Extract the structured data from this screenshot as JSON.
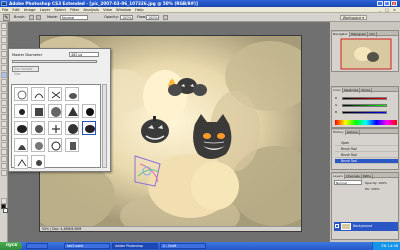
{
  "window": {
    "title": "Adobe Photoshop CS3 Extended - [pic_2007-03-06_107326.jpg @ 50% (RGB/8#)]",
    "app_icon_label": "Ps",
    "minimize_label": "_",
    "maximize_label": "□",
    "close_label": "×"
  },
  "menubar": {
    "items": [
      "File",
      "Edit",
      "Image",
      "Layer",
      "Select",
      "Filter",
      "Analysis",
      "View",
      "Window",
      "Help"
    ],
    "window_controls": [
      "_",
      "□",
      "×"
    ]
  },
  "options_bar": {
    "brush_label": "Brush:",
    "mode_label": "Mode:",
    "mode_value": "Normal",
    "opacity_label": "Opacity:",
    "opacity_value": "100%",
    "flow_label": "Flow:",
    "flow_value": "100%",
    "workspace_label": "Workspace ▾"
  },
  "brush_picker": {
    "master_diameter_label": "Master Diameter",
    "master_diameter_value": "482 px",
    "use_sample_size_label": "Use Sample Size",
    "brush_sizes": [
      "",
      "",
      "",
      "",
      "",
      "",
      "",
      "",
      "",
      "",
      "",
      "",
      "",
      "",
      "",
      "",
      "",
      "",
      "",
      ""
    ]
  },
  "document": {
    "zoom": "50%",
    "status": "50% | Doc: 4,48M/8,96M"
  },
  "panels": {
    "navigator_tabs": [
      "Navigator",
      "Histogram",
      "Info"
    ],
    "color_tabs": [
      "Color",
      "Swatches",
      "Styles"
    ],
    "color_channels": [
      "R",
      "G",
      "B"
    ],
    "history_tabs": [
      "History",
      "Actions"
    ],
    "history_items": [
      "Open",
      "Brush Tool",
      "Brush Tool",
      "Brush Tool"
    ],
    "layers_tabs": [
      "Layers",
      "Channels",
      "Paths"
    ],
    "layers_blend": "Normal",
    "layers_opacity": "Opacity: 100%",
    "layers_fill": "Fill: 100%",
    "layer_name": "Background"
  },
  "taskbar": {
    "start_label": "пуск",
    "tasks": [
      "",
      "tab3.www",
      "Adobe Photoshop",
      "S - Draft"
    ],
    "tray_language": "EN",
    "clock": "14:38"
  },
  "colors": {
    "titlebar": "#1f52c7",
    "selection": "#2a56c6",
    "foreground_swatch": "#111111",
    "background_swatch": "#ffffff"
  }
}
